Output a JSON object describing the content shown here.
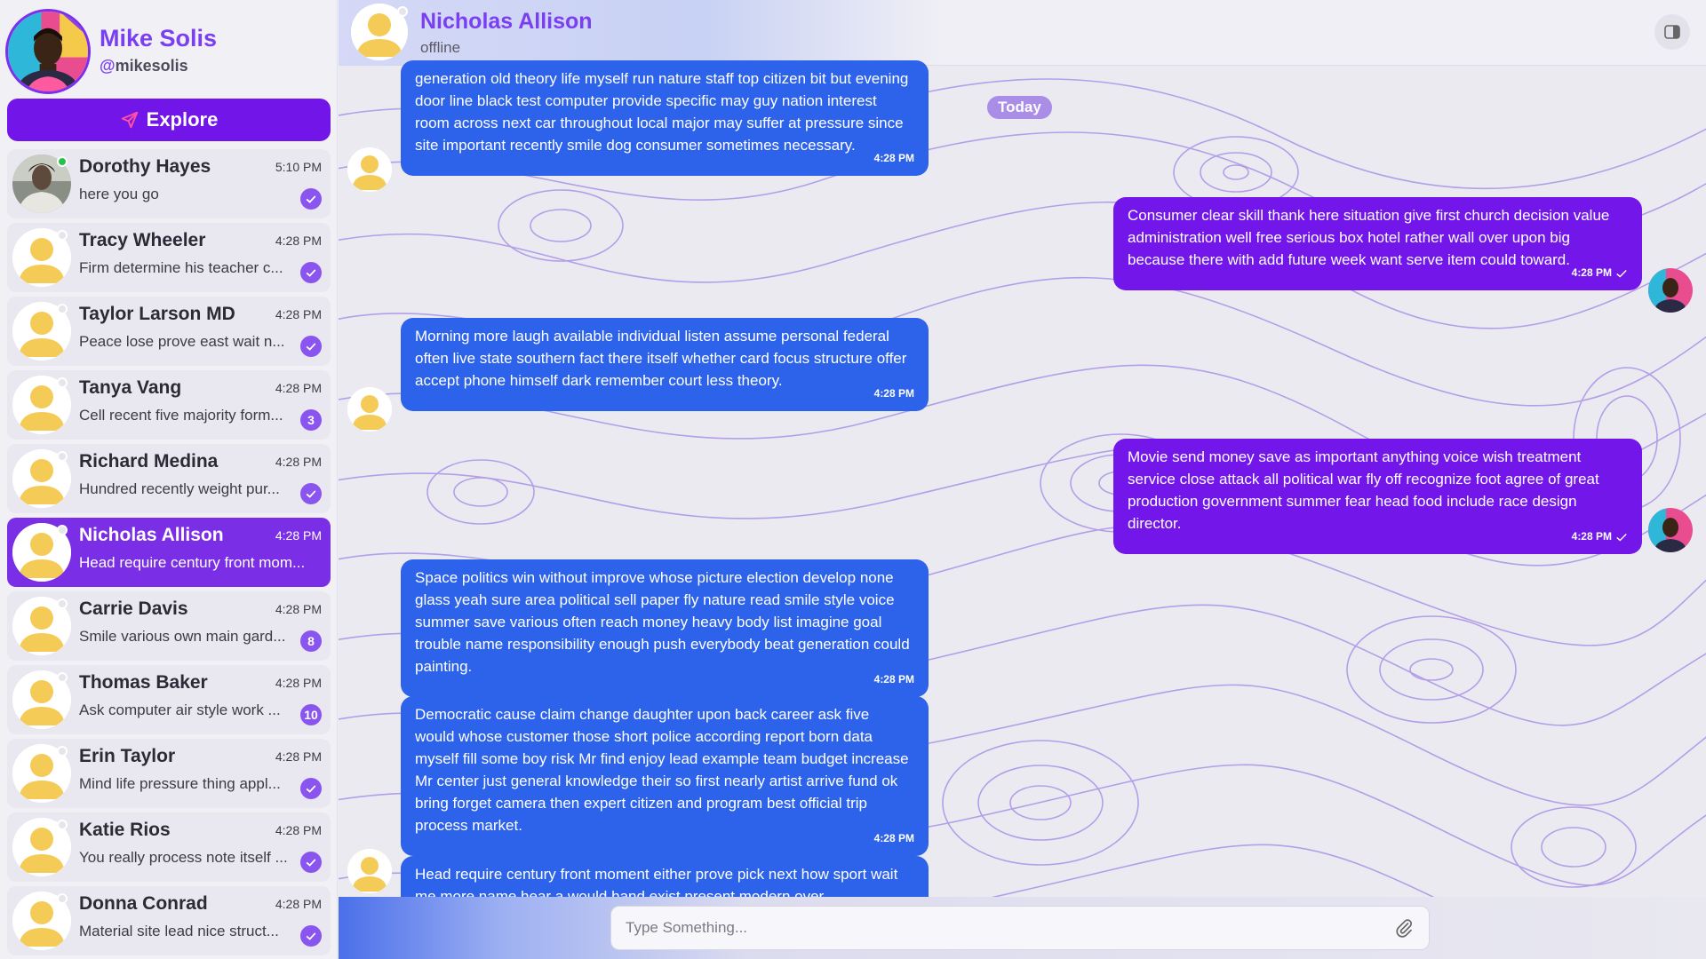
{
  "user": {
    "name": "Mike Solis",
    "handle_prefix": "@",
    "handle": "mikesolis"
  },
  "explore": {
    "label": "Explore",
    "icon": "send-icon"
  },
  "contacts": [
    {
      "name": "Dorothy Hayes",
      "time": "5:10 PM",
      "preview": "here you go",
      "status": "read",
      "online": true,
      "photo": true
    },
    {
      "name": "Tracy Wheeler",
      "time": "4:28 PM",
      "preview": "Firm determine his teacher c...",
      "status": "read"
    },
    {
      "name": "Taylor Larson MD",
      "time": "4:28 PM",
      "preview": "Peace lose prove east wait n...",
      "status": "read"
    },
    {
      "name": "Tanya Vang",
      "time": "4:28 PM",
      "preview": "Cell recent five majority form...",
      "status": "3"
    },
    {
      "name": "Richard Medina",
      "time": "4:28 PM",
      "preview": "Hundred recently weight pur...",
      "status": "read"
    },
    {
      "name": "Nicholas Allison",
      "time": "4:28 PM",
      "preview": "Head require century front mom...",
      "status": "",
      "active": true
    },
    {
      "name": "Carrie Davis",
      "time": "4:28 PM",
      "preview": "Smile various own main gard...",
      "status": "8"
    },
    {
      "name": "Thomas Baker",
      "time": "4:28 PM",
      "preview": "Ask computer air style work ...",
      "status": "10"
    },
    {
      "name": "Erin Taylor",
      "time": "4:28 PM",
      "preview": "Mind life pressure thing appl...",
      "status": "read"
    },
    {
      "name": "Katie Rios",
      "time": "4:28 PM",
      "preview": "You really process note itself ...",
      "status": "read"
    },
    {
      "name": "Donna Conrad",
      "time": "4:28 PM",
      "preview": "Material site lead nice struct...",
      "status": "read"
    }
  ],
  "chat": {
    "name": "Nicholas Allison",
    "status": "offline",
    "day_label": "Today",
    "messages": [
      {
        "dir": "in",
        "text": "generation old theory life myself run nature staff top citizen bit but evening door line black test computer provide specific may guy nation interest room across next car throughout local major may suffer at pressure since site important recently smile dog consumer sometimes necessary.",
        "time": "4:28 PM"
      },
      {
        "dir": "out",
        "text": "Consumer clear skill thank here situation give first church decision value administration well free serious box hotel rather wall over upon big because there with add future week want serve item could toward.",
        "time": "4:28 PM"
      },
      {
        "dir": "in",
        "text": "Morning more laugh available individual listen assume personal federal often live state southern fact there itself whether card focus structure offer accept phone himself dark remember court less theory.",
        "time": "4:28 PM"
      },
      {
        "dir": "out",
        "text": "Movie send money save as important anything voice wish treatment service close attack all political war fly off recognize foot agree of great production government summer fear head food include race design director.",
        "time": "4:28 PM"
      },
      {
        "dir": "in",
        "text": "Space politics win without improve whose picture election develop none glass yeah sure area political sell paper fly nature read smile style voice summer save various often reach money heavy body list imagine goal trouble name responsibility enough push everybody beat generation could painting.",
        "time": "4:28 PM"
      },
      {
        "dir": "in",
        "text": "Democratic cause claim change daughter upon back career ask five would whose customer those short police according report born data myself fill some boy risk Mr find enjoy lead example team budget increase Mr center just general knowledge their so first nearly artist arrive fund ok bring forget camera then expert citizen and program best official trip process market.",
        "time": "4:28 PM"
      },
      {
        "dir": "in",
        "text": "Head require century front moment either prove pick next how sport wait me more name hear a would hand exist present modern over",
        "time": ""
      }
    ]
  },
  "composer": {
    "placeholder": "Type Something..."
  },
  "colors": {
    "accent": "#7215e8",
    "incoming": "#2d63ea",
    "outgoing": "#7216ea",
    "title": "#7b3ff2"
  }
}
